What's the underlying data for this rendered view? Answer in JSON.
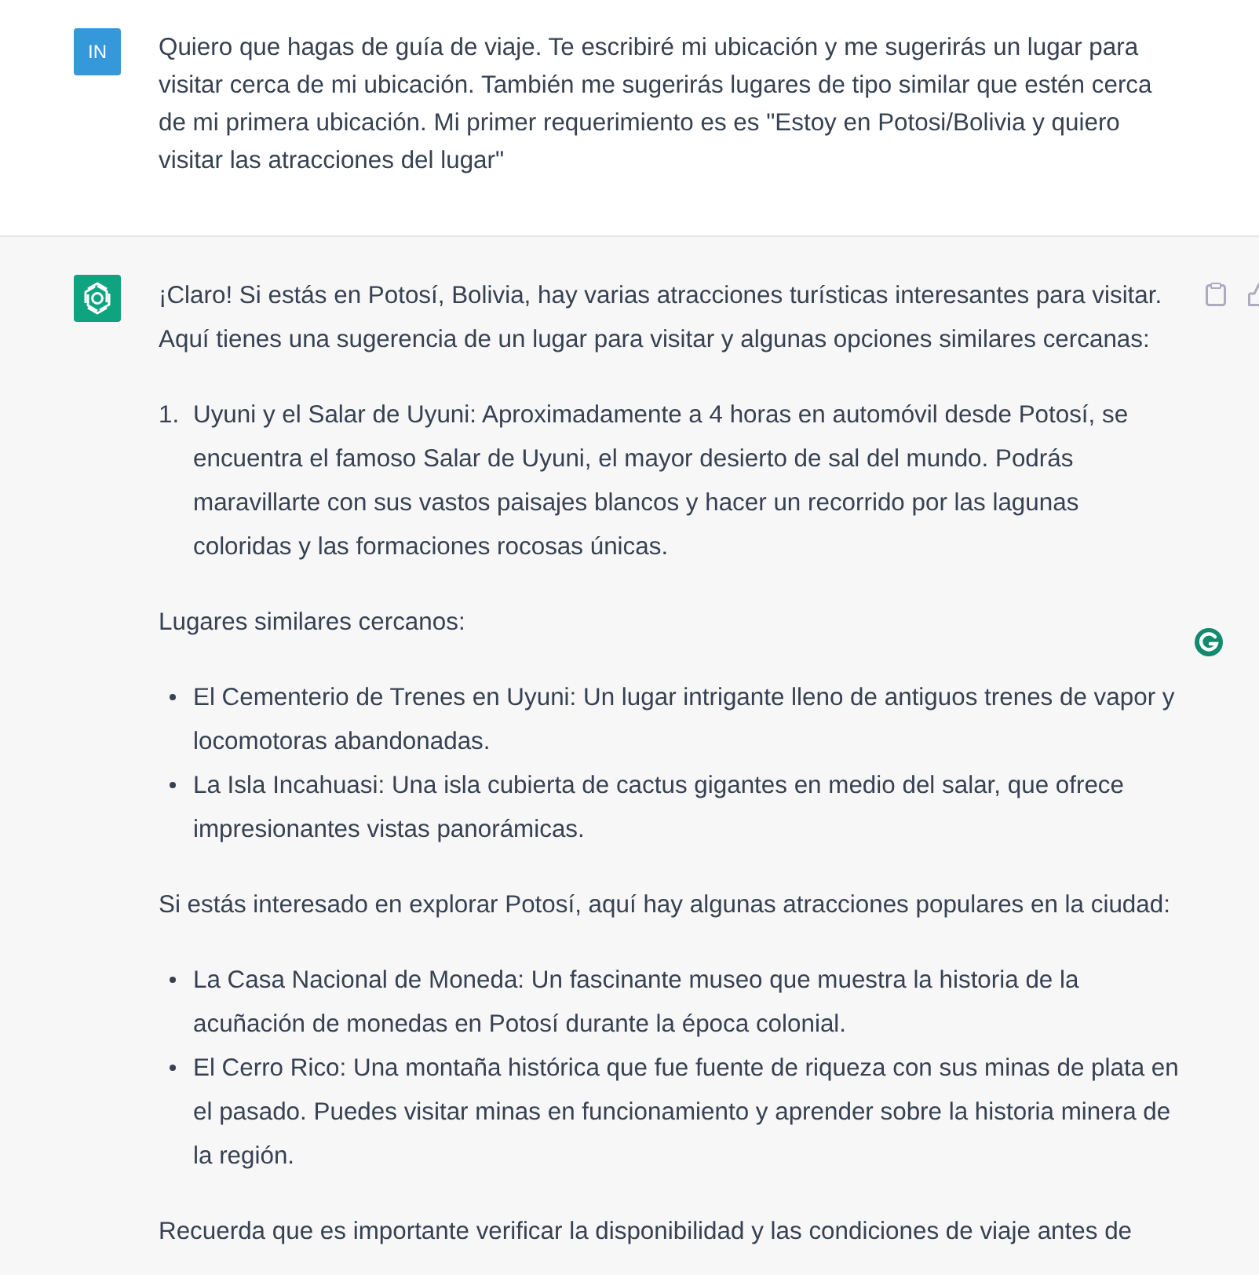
{
  "user_message": {
    "avatar_initials": "IN",
    "text": "Quiero que hagas de guía de viaje. Te escribiré mi ubicación y me sugerirás un lugar para visitar cerca de mi ubicación. También me sugerirás lugares de tipo similar que estén cerca de mi primera ubicación. Mi primer requerimiento es es \"Estoy en Potosi/Bolivia y quiero visitar las atracciones del lugar\""
  },
  "assistant_message": {
    "blocks": [
      {
        "kind": "paragraph",
        "text": "¡Claro! Si estás en Potosí, Bolivia, hay varias atracciones turísticas interesantes para visitar. Aquí tienes una sugerencia de un lugar para visitar y algunas opciones similares cercanas:"
      },
      {
        "kind": "ordered_list",
        "items": [
          {
            "marker": "1.",
            "text": "Uyuni y el Salar de Uyuni: Aproximadamente a 4 horas en automóvil desde Potosí, se encuentra el famoso Salar de Uyuni, el mayor desierto de sal del mundo. Podrás maravillarte con sus vastos paisajes blancos y hacer un recorrido por las lagunas coloridas y las formaciones rocosas únicas."
          }
        ]
      },
      {
        "kind": "paragraph",
        "text": "Lugares similares cercanos:"
      },
      {
        "kind": "bullet_list",
        "items": [
          {
            "text": "El Cementerio de Trenes en Uyuni: Un lugar intrigante lleno de antiguos trenes de vapor y locomotoras abandonadas."
          },
          {
            "text": "La Isla Incahuasi: Una isla cubierta de cactus gigantes en medio del salar, que ofrece impresionantes vistas panorámicas."
          }
        ]
      },
      {
        "kind": "paragraph",
        "text": "Si estás interesado en explorar Potosí, aquí hay algunas atracciones populares en la ciudad:"
      },
      {
        "kind": "bullet_list",
        "items": [
          {
            "text": "La Casa Nacional de Moneda: Un fascinante museo que muestra la historia de la acuñación de monedas en Potosí durante la época colonial."
          },
          {
            "text": "El Cerro Rico: Una montaña histórica que fue fuente de riqueza con sus minas de plata en el pasado. Puedes visitar minas en funcionamiento y aprender sobre la historia minera de la región."
          }
        ]
      },
      {
        "kind": "paragraph",
        "text": "Recuerda que es importante verificar la disponibilidad y las condiciones de viaje antes de"
      }
    ]
  }
}
